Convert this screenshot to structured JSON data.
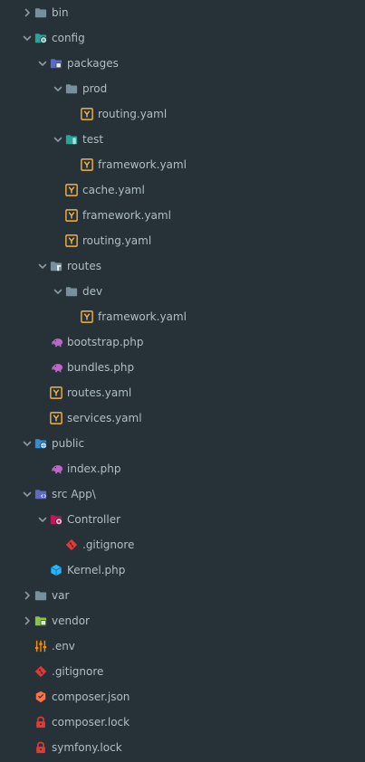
{
  "colors": {
    "background": "#263238",
    "text": "#b0bec5",
    "chevron": "#8a9aa2",
    "folder": "#78909c",
    "config_folder": "#26a69a",
    "packages_folder": "#5c6bc0",
    "test_folder": "#26a69a",
    "routes_folder": "#78909c",
    "public_folder": "#2f8fd8",
    "src_folder": "#5c6bc0",
    "controller_folder": "#c2185b",
    "vendor_folder": "#8bc34a",
    "yaml": "#f3b34a",
    "php": "#ba68c8",
    "git": "#e53935",
    "kernel": "#29b6f6",
    "env": "#fb8c00",
    "composer": "#ff7043",
    "lock": "#e53935"
  },
  "tree": [
    {
      "label": "bin",
      "depth": 0,
      "chevron": "collapsed",
      "icon": "folder-icon",
      "color": "#78909c"
    },
    {
      "label": "config",
      "depth": 0,
      "chevron": "expanded",
      "icon": "config-folder-icon",
      "color": "#26a69a"
    },
    {
      "label": "packages",
      "depth": 1,
      "chevron": "expanded",
      "icon": "packages-folder-icon",
      "color": "#5c6bc0"
    },
    {
      "label": "prod",
      "depth": 2,
      "chevron": "expanded",
      "icon": "folder-icon",
      "color": "#78909c"
    },
    {
      "label": "routing.yaml",
      "depth": 3,
      "chevron": "none",
      "icon": "yaml-icon",
      "color": "#f3b34a"
    },
    {
      "label": "test",
      "depth": 2,
      "chevron": "expanded",
      "icon": "test-folder-icon",
      "color": "#26a69a"
    },
    {
      "label": "framework.yaml",
      "depth": 3,
      "chevron": "none",
      "icon": "yaml-icon",
      "color": "#f3b34a"
    },
    {
      "label": "cache.yaml",
      "depth": 2,
      "chevron": "none",
      "icon": "yaml-icon",
      "color": "#f3b34a"
    },
    {
      "label": "framework.yaml",
      "depth": 2,
      "chevron": "none",
      "icon": "yaml-icon",
      "color": "#f3b34a"
    },
    {
      "label": "routing.yaml",
      "depth": 2,
      "chevron": "none",
      "icon": "yaml-icon",
      "color": "#f3b34a"
    },
    {
      "label": "routes",
      "depth": 1,
      "chevron": "expanded",
      "icon": "routes-folder-icon",
      "color": "#78909c"
    },
    {
      "label": "dev",
      "depth": 2,
      "chevron": "expanded",
      "icon": "folder-icon",
      "color": "#78909c"
    },
    {
      "label": "framework.yaml",
      "depth": 3,
      "chevron": "none",
      "icon": "yaml-icon",
      "color": "#f3b34a"
    },
    {
      "label": "bootstrap.php",
      "depth": 1,
      "chevron": "none",
      "icon": "php-elephant-icon",
      "color": "#ba68c8"
    },
    {
      "label": "bundles.php",
      "depth": 1,
      "chevron": "none",
      "icon": "php-elephant-icon",
      "color": "#ba68c8"
    },
    {
      "label": "routes.yaml",
      "depth": 1,
      "chevron": "none",
      "icon": "yaml-icon",
      "color": "#f3b34a"
    },
    {
      "label": "services.yaml",
      "depth": 1,
      "chevron": "none",
      "icon": "yaml-icon",
      "color": "#f3b34a"
    },
    {
      "label": "public",
      "depth": 0,
      "chevron": "expanded",
      "icon": "public-folder-icon",
      "color": "#2f8fd8"
    },
    {
      "label": "index.php",
      "depth": 1,
      "chevron": "none",
      "icon": "php-elephant-icon",
      "color": "#ba68c8"
    },
    {
      "label": "src App\\",
      "depth": 0,
      "chevron": "expanded",
      "icon": "src-folder-icon",
      "color": "#5c6bc0"
    },
    {
      "label": "Controller",
      "depth": 1,
      "chevron": "expanded",
      "icon": "controller-folder-icon",
      "color": "#c2185b"
    },
    {
      "label": ".gitignore",
      "depth": 2,
      "chevron": "none",
      "icon": "git-icon",
      "color": "#e53935"
    },
    {
      "label": "Kernel.php",
      "depth": 1,
      "chevron": "none",
      "icon": "kernel-cube-icon",
      "color": "#29b6f6"
    },
    {
      "label": "var",
      "depth": 0,
      "chevron": "collapsed",
      "icon": "folder-icon",
      "color": "#78909c"
    },
    {
      "label": "vendor",
      "depth": 0,
      "chevron": "collapsed",
      "icon": "vendor-folder-icon",
      "color": "#8bc34a"
    },
    {
      "label": ".env",
      "depth": 0,
      "chevron": "none",
      "icon": "env-sliders-icon",
      "color": "#fb8c00"
    },
    {
      "label": ".gitignore",
      "depth": 0,
      "chevron": "none",
      "icon": "git-icon",
      "color": "#e53935"
    },
    {
      "label": "composer.json",
      "depth": 0,
      "chevron": "none",
      "icon": "composer-icon",
      "color": "#ff7043"
    },
    {
      "label": "composer.lock",
      "depth": 0,
      "chevron": "none",
      "icon": "lock-icon",
      "color": "#e53935"
    },
    {
      "label": "symfony.lock",
      "depth": 0,
      "chevron": "none",
      "icon": "lock-icon",
      "color": "#e53935"
    }
  ]
}
